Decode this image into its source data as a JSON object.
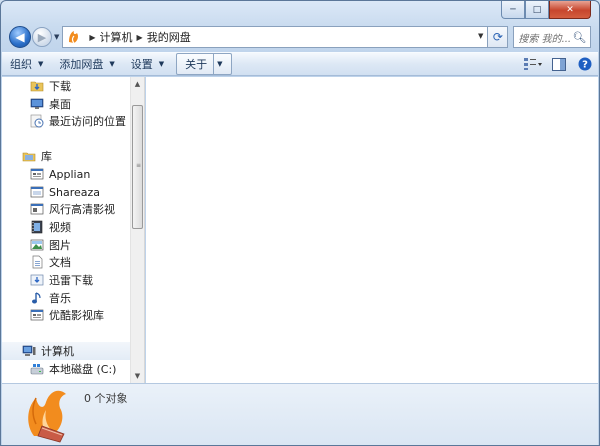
{
  "window": {
    "caption": {
      "minimize": "─",
      "maximize": "□",
      "close": "✕"
    }
  },
  "nav": {
    "back_icon": "arrow-left-icon",
    "forward_icon": "arrow-right-icon",
    "breadcrumbs": [
      "计算机",
      "我的网盘"
    ],
    "search_placeholder": "搜索 我的...",
    "refresh_icon": "refresh-icon"
  },
  "toolbar": {
    "organize": "组织",
    "add_drive": "添加网盘",
    "settings": "设置",
    "about": "关于"
  },
  "sidebar": {
    "favorites": [
      {
        "label": "下载",
        "icon": "download-folder-icon"
      },
      {
        "label": "桌面",
        "icon": "desktop-icon"
      },
      {
        "label": "最近访问的位置",
        "icon": "recent-places-icon"
      }
    ],
    "library_header": "库",
    "library": [
      {
        "label": "Applian",
        "icon": "app-icon"
      },
      {
        "label": "Shareaza",
        "icon": "app-icon"
      },
      {
        "label": "风行高清影视",
        "icon": "app-icon"
      },
      {
        "label": "视频",
        "icon": "video-icon"
      },
      {
        "label": "图片",
        "icon": "picture-icon"
      },
      {
        "label": "文档",
        "icon": "document-icon"
      },
      {
        "label": "迅雷下载",
        "icon": "download-icon"
      },
      {
        "label": "音乐",
        "icon": "music-icon"
      },
      {
        "label": "优酷影视库",
        "icon": "app-icon"
      }
    ],
    "computer_header": "计算机",
    "computer": [
      {
        "label": "本地磁盘 (C:)",
        "icon": "hard-disk-icon"
      }
    ]
  },
  "details": {
    "count": "0 个对象"
  },
  "colors": {
    "accent": "#2a6fc9",
    "close": "#c7462d",
    "fox": "#f28c1e"
  }
}
